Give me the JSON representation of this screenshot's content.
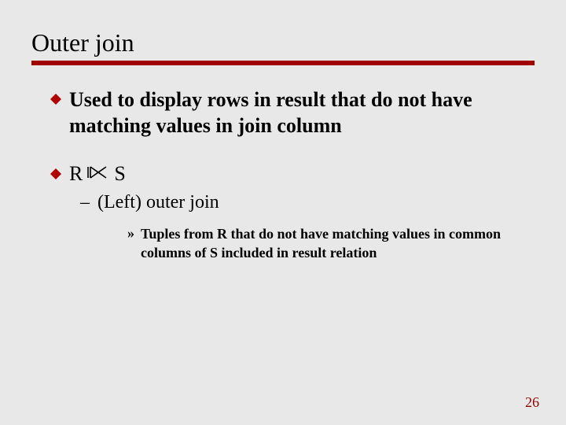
{
  "title": "Outer join",
  "bullets": [
    {
      "text": "Used to display rows in result that do not have matching values in join column"
    },
    {
      "expr": {
        "left": "R",
        "right": "S"
      },
      "sub": {
        "text": "(Left) outer join",
        "sub": {
          "text": "Tuples from R that do not have matching values in common columns of S included in result relation"
        }
      }
    }
  ],
  "page_number": "26"
}
